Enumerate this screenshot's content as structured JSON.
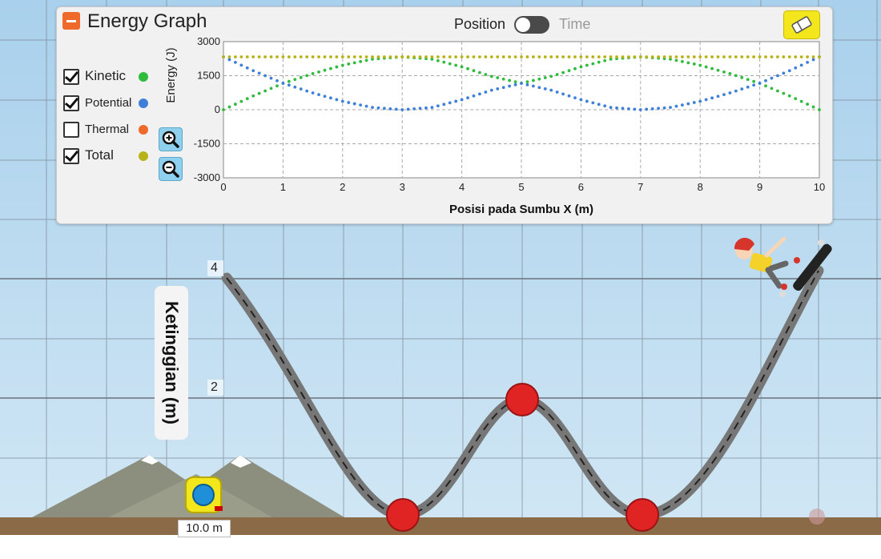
{
  "panel": {
    "title": "Energy Graph",
    "toggle_left_label": "Position",
    "toggle_right_label": "Time",
    "legend": [
      {
        "label": "Kinetic",
        "checked": true,
        "color": "#2fbb3c"
      },
      {
        "label": "Potential",
        "checked": true,
        "color": "#3d7fd9"
      },
      {
        "label": "Thermal",
        "checked": false,
        "color": "#ef6a2a"
      },
      {
        "label": "Total",
        "checked": true,
        "color": "#b8b21a"
      }
    ]
  },
  "chart_data": {
    "type": "scatter",
    "ylabel": "Energy (J)",
    "xlabel": "Posisi pada Sumbu X (m)",
    "xlim": [
      0,
      10
    ],
    "ylim": [
      -3000,
      3000
    ],
    "x_ticks": [
      "0",
      "1",
      "2",
      "3",
      "4",
      "5",
      "6",
      "7",
      "8",
      "9",
      "10"
    ],
    "y_ticks": [
      "3000",
      "1500",
      "0",
      "-1500",
      "-3000"
    ],
    "grid": true,
    "series": [
      {
        "name": "Kinetic",
        "color": "#2fbb3c",
        "x": [
          0,
          0.5,
          1,
          1.5,
          2,
          2.5,
          3,
          3.5,
          4,
          4.5,
          5,
          5.5,
          6,
          6.5,
          7,
          7.5,
          8,
          8.5,
          9,
          9.5,
          10
        ],
        "y": [
          0,
          610,
          1160,
          1590,
          1960,
          2230,
          2330,
          2230,
          1890,
          1470,
          1170,
          1470,
          1890,
          2230,
          2330,
          2230,
          1960,
          1590,
          1160,
          610,
          0
        ]
      },
      {
        "name": "Potential",
        "color": "#3d7fd9",
        "x": [
          0,
          0.5,
          1,
          1.5,
          2,
          2.5,
          3,
          3.5,
          4,
          4.5,
          5,
          5.5,
          6,
          6.5,
          7,
          7.5,
          8,
          8.5,
          9,
          9.5,
          10
        ],
        "y": [
          2330,
          1720,
          1170,
          740,
          370,
          100,
          0,
          100,
          440,
          860,
          1160,
          860,
          440,
          100,
          0,
          100,
          370,
          740,
          1170,
          1720,
          2330
        ]
      },
      {
        "name": "Total",
        "color": "#b8b21a",
        "x": [
          0,
          10
        ],
        "y": [
          2330,
          2330
        ]
      }
    ]
  },
  "scene": {
    "height_axis_label": "Ketinggian (m)",
    "height_ticks": [
      "4",
      "2"
    ],
    "tape_measure_label": "10.0 m"
  }
}
